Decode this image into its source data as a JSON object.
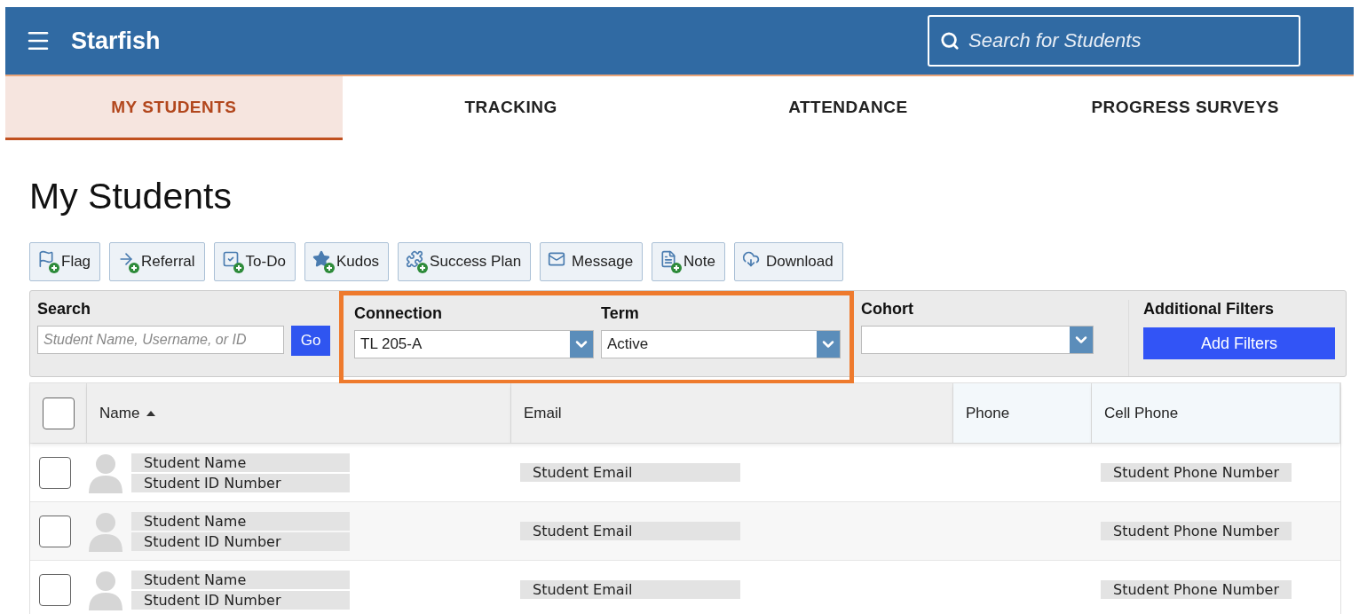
{
  "header": {
    "app_name": "Starfish",
    "search": {
      "placeholder": "Search for Students"
    }
  },
  "tabs": [
    {
      "label": "MY STUDENTS",
      "selected": true
    },
    {
      "label": "TRACKING",
      "selected": false
    },
    {
      "label": "ATTENDANCE",
      "selected": false
    },
    {
      "label": "PROGRESS SURVEYS",
      "selected": false
    }
  ],
  "page_title": "My Students",
  "toolbar": [
    "Flag",
    "Referral",
    "To-Do",
    "Kudos",
    "Success Plan",
    "Message",
    "Note",
    "Download"
  ],
  "filters": {
    "search": {
      "label": "Search",
      "placeholder": "Student Name, Username, or ID",
      "button": "Go"
    },
    "dropdowns": [
      {
        "label": "Connection",
        "value": "TL 205-A",
        "highlighted": true
      },
      {
        "label": "Term",
        "value": "Active",
        "highlighted": true
      },
      {
        "label": "Cohort",
        "highlighted": false
      }
    ],
    "additional": {
      "label": "Additional Filters",
      "button": "Add Filters"
    }
  },
  "table": {
    "select_all_checked": false,
    "columns": [
      {
        "label": "Name",
        "sorted": true
      },
      {
        "label": "Email"
      },
      {
        "label": "Phone"
      },
      {
        "label": "Cell Phone"
      }
    ],
    "rows": [
      {
        "checked": false,
        "name": "Student Name",
        "id": "Student ID Number",
        "email": "Student Email",
        "cell_phone": "Student Phone Number"
      },
      {
        "checked": false,
        "name": "Student Name",
        "id": "Student ID Number",
        "email": "Student Email",
        "cell_phone": "Student Phone Number"
      },
      {
        "checked": false,
        "name": "Student Name",
        "id": "Student ID Number",
        "email": "Student Email",
        "cell_phone": "Student Phone Number"
      }
    ]
  }
}
